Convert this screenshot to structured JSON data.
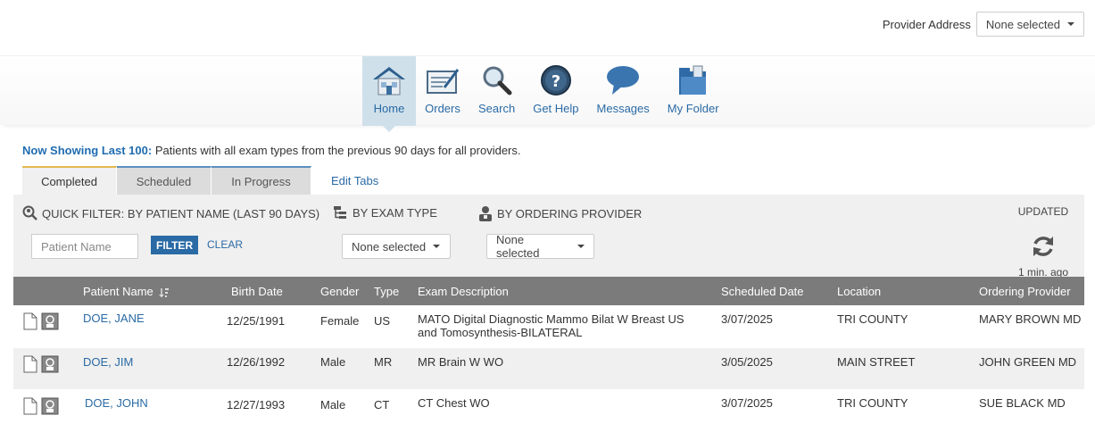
{
  "provider_address": {
    "label": "Provider Address",
    "value": "None selected"
  },
  "nav": [
    {
      "label": "Home",
      "icon": "home-icon",
      "active": true
    },
    {
      "label": "Orders",
      "icon": "orders-icon"
    },
    {
      "label": "Search",
      "icon": "search-icon"
    },
    {
      "label": "Get Help",
      "icon": "help-icon"
    },
    {
      "label": "Messages",
      "icon": "messages-icon"
    },
    {
      "label": "My Folder",
      "icon": "folder-icon"
    }
  ],
  "showing": {
    "highlight": "Now Showing Last 100:",
    "text": "Patients with all exam types from the previous 90 days for all providers."
  },
  "tabs": [
    {
      "label": "Completed",
      "active": true
    },
    {
      "label": "Scheduled"
    },
    {
      "label": "In Progress"
    }
  ],
  "edit_tabs": "Edit Tabs",
  "filters": {
    "quick_filter_label": "QUICK FILTER: BY PATIENT NAME (LAST 90 DAYS)",
    "patient_placeholder": "Patient Name",
    "filter_button": "FILTER",
    "clear_link": "CLEAR",
    "exam_type_label": "BY EXAM TYPE",
    "exam_type_value": "None selected",
    "ordering_provider_label": "BY ORDERING PROVIDER",
    "ordering_provider_value": "None selected",
    "updated_label": "UPDATED",
    "updated_ago": "1 min. ago"
  },
  "table": {
    "columns": [
      "Patient Name",
      "Birth Date",
      "Gender",
      "Type",
      "Exam Description",
      "Scheduled Date",
      "Location",
      "Ordering Provider"
    ],
    "rows": [
      {
        "name": "DOE, JANE",
        "birth": "12/25/1991",
        "gender": "Female",
        "type": "US",
        "desc": "MATO Digital Diagnostic Mammo Bilat W Breast US and Tomosynthesis-BILATERAL",
        "sched": "3/07/2025",
        "location": "TRI COUNTY",
        "provider": "MARY BROWN MD"
      },
      {
        "name": "DOE, JIM",
        "birth": "12/26/1992",
        "gender": "Male",
        "type": "MR",
        "desc": "MR Brain W WO",
        "sched": "3/05/2025",
        "location": "MAIN STREET",
        "provider": "JOHN GREEN MD"
      },
      {
        "name": "DOE, JOHN",
        "birth": "12/27/1993",
        "gender": "Male",
        "type": "CT",
        "desc": "CT Chest WO",
        "sched": "3/07/2025",
        "location": "TRI COUNTY",
        "provider": "SUE BLACK MD"
      }
    ]
  }
}
